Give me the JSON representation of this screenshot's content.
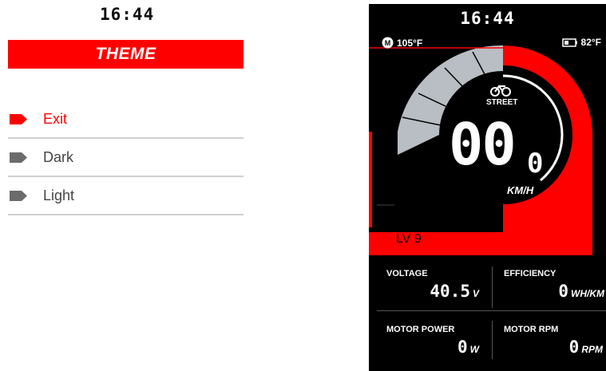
{
  "settings": {
    "time": "16:44",
    "title": "THEME",
    "items": [
      {
        "label": "Exit",
        "active": true
      },
      {
        "label": "Dark",
        "active": false
      },
      {
        "label": "Light",
        "active": false
      }
    ],
    "colors": {
      "accent": "#ff0000",
      "inactive_tag": "#6b6b6b",
      "divider": "#d0d0d0"
    }
  },
  "dashboard": {
    "time": "16:44",
    "motor_temp": "105°F",
    "battery_temp": "82°F",
    "icons": {
      "motor": "motor-temp-icon",
      "battery": "battery-icon",
      "mode": "ride-mode-icon"
    },
    "mode": "STREET",
    "speed_int": "00",
    "speed_dec": "0",
    "speed_unit": "KM/H",
    "level": "LV 9",
    "stats": [
      {
        "title": "VOLTAGE",
        "value": "40.5",
        "unit": "V"
      },
      {
        "title": "EFFICIENCY",
        "value": "0",
        "unit": "WH/KM"
      },
      {
        "title": "MOTOR POWER",
        "value": "0",
        "unit": "W"
      },
      {
        "title": "MOTOR RPM",
        "value": "0",
        "unit": "RPM"
      }
    ],
    "colors": {
      "accent": "#ff0000",
      "background": "#000000",
      "gauge_grey": "#b8bec3"
    }
  }
}
